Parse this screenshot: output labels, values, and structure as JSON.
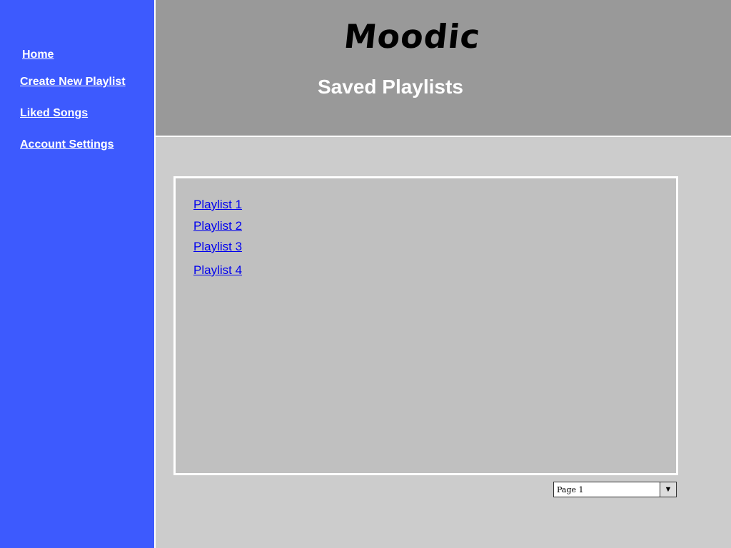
{
  "sidebar": {
    "items": [
      {
        "label": "Home"
      },
      {
        "label": "Create New Playlist"
      },
      {
        "label": "Liked Songs"
      },
      {
        "label": "Account Settings"
      }
    ]
  },
  "header": {
    "app_title": "Moodic",
    "page_title": "Saved Playlists"
  },
  "main": {
    "playlists": [
      {
        "label": "Playlist 1"
      },
      {
        "label": "Playlist 2"
      },
      {
        "label": "Playlist 3"
      },
      {
        "label": "Playlist 4"
      }
    ],
    "pagination": {
      "selected": "Page 1",
      "arrow_icon": "dropdown-triangle-icon"
    }
  },
  "colors": {
    "sidebar_bg": "#3d5afe",
    "header_bg": "#999999",
    "content_bg": "#cccccc",
    "panel_bg": "#c0c0c0",
    "link": "#0000ee"
  }
}
